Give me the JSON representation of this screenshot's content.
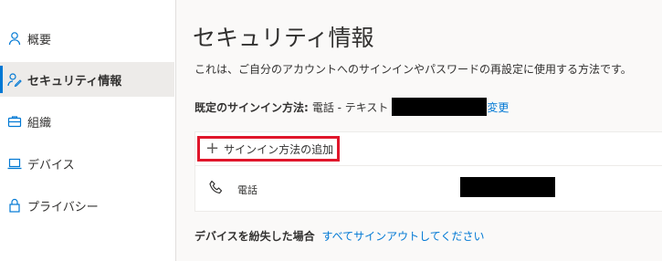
{
  "sidebar": {
    "items": [
      {
        "label": "概要",
        "icon": "person-icon"
      },
      {
        "label": "セキュリティ情報",
        "icon": "security-info-icon"
      },
      {
        "label": "組織",
        "icon": "briefcase-icon"
      },
      {
        "label": "デバイス",
        "icon": "laptop-icon"
      },
      {
        "label": "プライバシー",
        "icon": "lock-icon"
      }
    ],
    "active": "セキュリティ情報"
  },
  "main": {
    "title": "セキュリティ情報",
    "description": "これは、ご自分のアカウントへのサインインやパスワードの再設定に使用する方法です。",
    "default_method": {
      "label": "既定のサインイン方法:",
      "value": "電話 - テキスト",
      "change_link": "変更"
    },
    "add_method_label": "サインイン方法の追加",
    "methods": [
      {
        "name": "電話",
        "icon": "phone-icon"
      }
    ],
    "lost_device": {
      "label": "デバイスを紛失した場合",
      "link": "すべてサインアウトしてください"
    }
  },
  "colors": {
    "accent": "#0078d4",
    "highlight_box": "#e0162b"
  }
}
